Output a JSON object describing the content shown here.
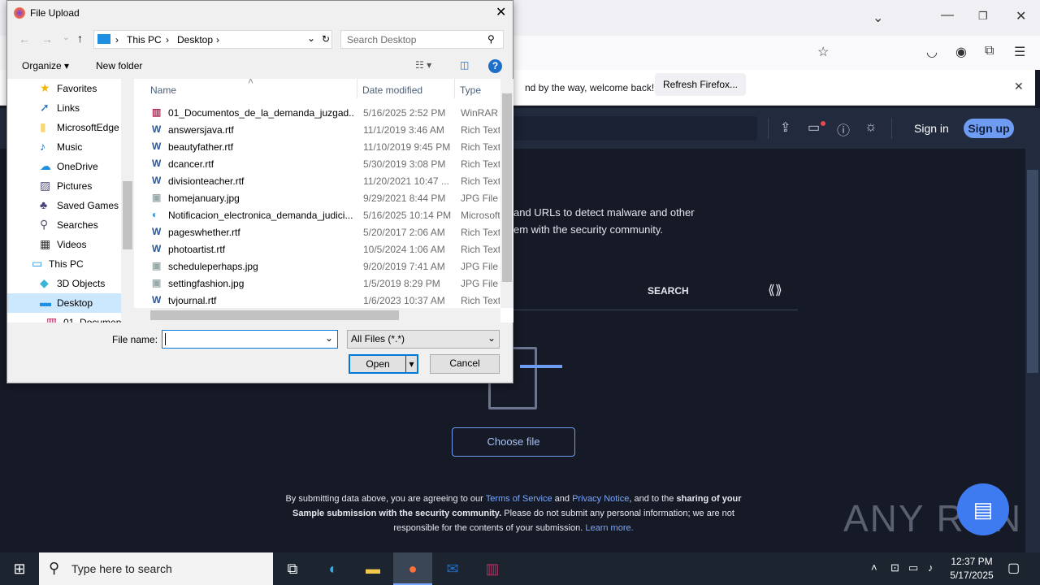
{
  "browser": {
    "notification_text": "nd by the way, welcome back!",
    "refresh_button": "Refresh Firefox...",
    "sign_in": "Sign in",
    "sign_up": "Sign up"
  },
  "page": {
    "intro_line1": "and URLs to detect malware and other",
    "intro_line2": "em with the security community.",
    "search_tab": "SEARCH",
    "choose_file": "Choose file",
    "disclaimer_1": "By submitting data above, you are agreeing to our ",
    "terms": "Terms of Service",
    "and": " and ",
    "privacy": "Privacy Notice",
    "disclaimer_2": ", and to the ",
    "sharing": "sharing of your Sample submission with the security community.",
    "disclaimer_3": " Please do not submit any personal information; we are not responsible for the contents of your submission. ",
    "learn_more": "Learn more.",
    "watermark": "ANY RUN"
  },
  "dialog": {
    "title": "File Upload",
    "breadcrumb": [
      "This PC",
      "Desktop"
    ],
    "search_placeholder": "Search Desktop",
    "organize": "Organize",
    "new_folder": "New folder",
    "nav": [
      {
        "label": "Favorites",
        "icon": "star"
      },
      {
        "label": "Links",
        "icon": "link"
      },
      {
        "label": "MicrosoftEdge",
        "icon": "folder"
      },
      {
        "label": "Music",
        "icon": "music"
      },
      {
        "label": "OneDrive",
        "icon": "cloud"
      },
      {
        "label": "Pictures",
        "icon": "picture"
      },
      {
        "label": "Saved Games",
        "icon": "games"
      },
      {
        "label": "Searches",
        "icon": "search"
      },
      {
        "label": "Videos",
        "icon": "video"
      },
      {
        "label": "This PC",
        "icon": "pc"
      },
      {
        "label": "3D Objects",
        "icon": "cube"
      },
      {
        "label": "Desktop",
        "icon": "desktop"
      },
      {
        "label": "01_Documen",
        "icon": "archive"
      }
    ],
    "columns": [
      "Name",
      "Date modified",
      "Type"
    ],
    "files": [
      {
        "name": "01_Documentos_de_la_demanda_juzgad...",
        "date": "5/16/2025 2:52 PM",
        "type": "WinRAR Z",
        "icon": "rar"
      },
      {
        "name": "answersjava.rtf",
        "date": "11/1/2019 3:46 AM",
        "type": "Rich Text",
        "icon": "word"
      },
      {
        "name": "beautyfather.rtf",
        "date": "11/10/2019 9:45 PM",
        "type": "Rich Text",
        "icon": "word"
      },
      {
        "name": "dcancer.rtf",
        "date": "5/30/2019 3:08 PM",
        "type": "Rich Text",
        "icon": "word"
      },
      {
        "name": "divisionteacher.rtf",
        "date": "11/20/2021 10:47 ...",
        "type": "Rich Text",
        "icon": "word"
      },
      {
        "name": "homejanuary.jpg",
        "date": "9/29/2021 8:44 PM",
        "type": "JPG File",
        "icon": "image"
      },
      {
        "name": "Notificacion_electronica_demanda_judici...",
        "date": "5/16/2025 10:14 PM",
        "type": "Microsoft",
        "icon": "edge"
      },
      {
        "name": "pageswhether.rtf",
        "date": "5/20/2017 2:06 AM",
        "type": "Rich Text",
        "icon": "word"
      },
      {
        "name": "photoartist.rtf",
        "date": "10/5/2024 1:06 AM",
        "type": "Rich Text",
        "icon": "word"
      },
      {
        "name": "scheduleperhaps.jpg",
        "date": "9/20/2019 7:41 AM",
        "type": "JPG File",
        "icon": "image"
      },
      {
        "name": "settingfashion.jpg",
        "date": "1/5/2019 8:29 PM",
        "type": "JPG File",
        "icon": "image"
      },
      {
        "name": "tvjournal.rtf",
        "date": "1/6/2023 10:37 AM",
        "type": "Rich Text",
        "icon": "word"
      }
    ],
    "file_name_label": "File name:",
    "file_name_value": "",
    "filter": "All Files (*.*)",
    "open": "Open",
    "cancel": "Cancel"
  },
  "taskbar": {
    "search_placeholder": "Type here to search",
    "time": "12:37 PM",
    "date": "5/17/2025"
  }
}
